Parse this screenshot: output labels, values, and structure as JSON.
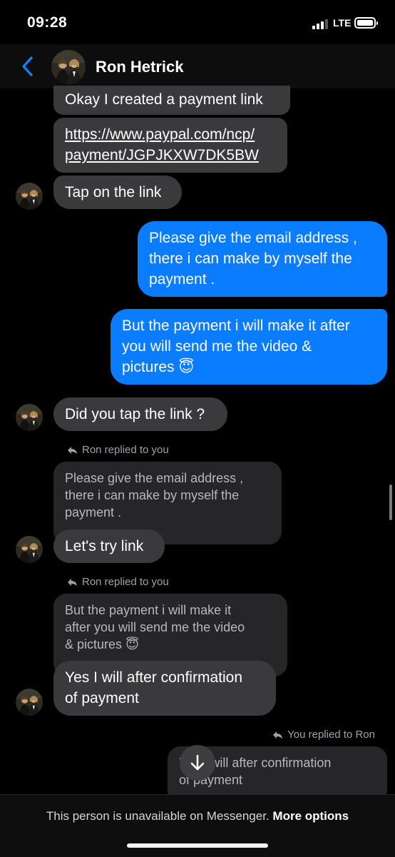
{
  "status": {
    "time": "09:28",
    "network": "LTE"
  },
  "header": {
    "contact_name": "Ron Hetrick"
  },
  "messages": {
    "m1": "Okay I created a payment link",
    "m2_line1": "https://www.paypal.com/ncp/",
    "m2_line2": "payment/JGPJKXW7DK5BW",
    "m3": "Tap on the link",
    "m4_line1": "Please give the email address ,",
    "m4_line2": "there i can make by myself the",
    "m4_line3": "payment .",
    "m5_line1": "But the payment i will make it after",
    "m5_line2": "you will send me the video &",
    "m5_line3": "pictures",
    "m6": "Did you tap the link ?",
    "reply1_label": "Ron replied to you",
    "q1_line1": "Please give the email address ,",
    "q1_line2": "there i can make by myself the",
    "q1_line3": "payment .",
    "m7": "Let's try link",
    "reply2_label": "Ron replied to you",
    "q2_line1": "But the payment i will make it",
    "q2_line2": "after you will send me the video",
    "q2_line3": "& pictures",
    "m8_line1": "Yes I will after confirmation",
    "m8_line2": "of payment",
    "reply3_label": "You replied to Ron",
    "q3_line1": "Yes I will after confirmation",
    "q3_line2": "of payment"
  },
  "emoji": {
    "smiling_halo": "😇"
  },
  "footer": {
    "notice": "This person is unavailable on Messenger.",
    "more_options": "More options"
  },
  "colors": {
    "outgoing": "#0a7cff",
    "incoming": "#3a3a3c",
    "accent": "#0a84ff"
  }
}
